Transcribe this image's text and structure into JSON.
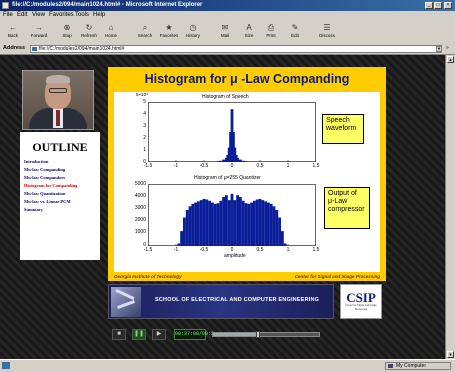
{
  "window": {
    "title": "file://C:/modules2/094/main1024.html# - Microsoft Internet Explorer",
    "controls": [
      "_",
      "□",
      "×"
    ]
  },
  "menu": [
    "File",
    "Edit",
    "View",
    "Favorites",
    "Tools",
    "Help"
  ],
  "toolbar": [
    {
      "label": "Back",
      "icon": "←"
    },
    {
      "label": "Forward",
      "icon": "→"
    },
    {
      "label": "Stop",
      "icon": "⊗"
    },
    {
      "label": "Refresh",
      "icon": "↻"
    },
    {
      "label": "Home",
      "icon": "⌂"
    },
    {
      "label": "Search",
      "icon": "⌕"
    },
    {
      "label": "Favorites",
      "icon": "★"
    },
    {
      "label": "History",
      "icon": "◷"
    },
    {
      "label": "Mail",
      "icon": "✉"
    },
    {
      "label": "Size",
      "icon": "A"
    },
    {
      "label": "Print",
      "icon": "⎙"
    },
    {
      "label": "Edit",
      "icon": "✎"
    },
    {
      "label": "Discuss",
      "icon": "☰"
    }
  ],
  "address": {
    "label": "Address",
    "value": "file://C:/modules2/094/main1024.html#",
    "links": "»"
  },
  "outline": {
    "heading": "OUTLINE",
    "items": [
      {
        "label": "Introduction",
        "active": false
      },
      {
        "label": "Mu-law Companding",
        "active": false
      },
      {
        "label": "Mu-law Compandors",
        "active": false
      },
      {
        "label": "Histogram for Companding",
        "active": true
      },
      {
        "label": "Mu-law Quantization",
        "active": false
      },
      {
        "label": "Mu-law vs. Linear PCM",
        "active": false
      },
      {
        "label": "Summary",
        "active": false
      }
    ]
  },
  "slide": {
    "title": "Histogram for μ -Law Companding",
    "footer_left": "Georgia Institute of Technology",
    "footer_right": "Center for Signal and Image Processing",
    "note_top": [
      "Speech",
      "waveform"
    ],
    "note_bottom": [
      "Output of",
      "μ-Law",
      "compressor"
    ]
  },
  "chart_data": [
    {
      "type": "bar",
      "title": "Histogram of Speech",
      "y_multiplier": "5×10⁴",
      "x_ticks": [
        "-1.5",
        "-1",
        "-0.5",
        "0",
        "0.5",
        "1",
        "1.5"
      ],
      "y_ticks": [
        "5",
        "4",
        "3",
        "2",
        "1",
        "0"
      ],
      "xlim": [
        -1.5,
        1.5
      ],
      "ylim": [
        0,
        5
      ],
      "x": [
        -0.25,
        -0.2,
        -0.15,
        -0.1,
        -0.075,
        -0.05,
        -0.025,
        0,
        0.025,
        0.05,
        0.075,
        0.1,
        0.15,
        0.2,
        0.25
      ],
      "values": [
        0.05,
        0.1,
        0.2,
        0.35,
        0.6,
        1.2,
        2.5,
        4.4,
        2.5,
        1.2,
        0.6,
        0.35,
        0.2,
        0.1,
        0.05
      ]
    },
    {
      "type": "bar",
      "title": "Histogram of μ=255 Quantizer",
      "xlabel": "amplitude",
      "x_ticks": [
        "-1.5",
        "-1",
        "-0.5",
        "0",
        "0.5",
        "1",
        "1.5"
      ],
      "y_ticks": [
        "5000",
        "4000",
        "3000",
        "2000",
        "1000",
        "0"
      ],
      "xlim": [
        -1.5,
        1.5
      ],
      "ylim": [
        0,
        5000
      ],
      "x": [
        -0.95,
        -0.9,
        -0.85,
        -0.8,
        -0.75,
        -0.7,
        -0.65,
        -0.6,
        -0.55,
        -0.5,
        -0.45,
        -0.4,
        -0.35,
        -0.3,
        -0.25,
        -0.2,
        -0.15,
        -0.1,
        -0.05,
        0,
        0.05,
        0.1,
        0.15,
        0.2,
        0.25,
        0.3,
        0.35,
        0.4,
        0.45,
        0.5,
        0.55,
        0.6,
        0.65,
        0.7,
        0.75,
        0.8,
        0.85,
        0.9,
        0.95
      ],
      "values": [
        200,
        1200,
        2300,
        2900,
        3200,
        3400,
        3500,
        3600,
        3700,
        3800,
        3750,
        3650,
        3500,
        3400,
        3450,
        3650,
        3950,
        4100,
        3700,
        4200,
        3700,
        4100,
        3950,
        3650,
        3450,
        3400,
        3500,
        3650,
        3750,
        3800,
        3700,
        3600,
        3500,
        3400,
        3200,
        2900,
        2300,
        1200,
        200
      ]
    }
  ],
  "banner": {
    "text": "SCHOOL OF ELECTRICAL AND COMPUTER ENGINEERING"
  },
  "csip": {
    "title": "CSIP",
    "subtitle": "Center for Signal and Image Processing"
  },
  "media": {
    "time": "00:37:00/00:2",
    "progress": 0.42
  },
  "status": {
    "zone": "My Computer"
  },
  "colors": {
    "slide_bg": "#ffcc00",
    "title_blue": "#0c1a7a",
    "bar_blue": "#0a1e9a",
    "active_red": "#d00000"
  }
}
